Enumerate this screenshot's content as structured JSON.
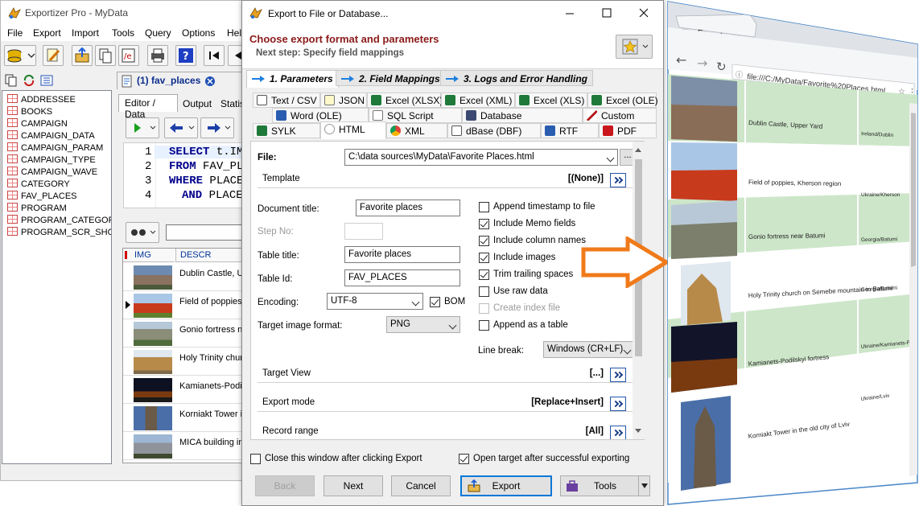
{
  "main": {
    "title": "Exportizer Pro - MyData",
    "menu": [
      "File",
      "Export",
      "Import",
      "Tools",
      "Query",
      "Options",
      "Help"
    ],
    "tables": [
      "ADDRESSEE",
      "BOOKS",
      "CAMPAIGN",
      "CAMPAIGN_DATA",
      "CAMPAIGN_PARAM",
      "CAMPAIGN_TYPE",
      "CAMPAIGN_WAVE",
      "CATEGORY",
      "FAV_PLACES",
      "PROGRAM",
      "PROGRAM_CATEGORY",
      "PROGRAM_SCR_SHOT"
    ],
    "doc_tab": "(1) fav_places",
    "inner_tabs": [
      "Editor / Data",
      "Output",
      "Statist"
    ],
    "sql": {
      "lines": [
        {
          "num": "1",
          "kw": "SELECT",
          "rest": " t.IMG"
        },
        {
          "num": "2",
          "kw": "FROM",
          "rest": " FAV_PLA"
        },
        {
          "num": "3",
          "kw": "WHERE",
          "rest": " PLACE"
        },
        {
          "num": "4",
          "kw": "AND",
          "rest": " PLACE"
        }
      ]
    },
    "grid": {
      "columns": [
        "IMG",
        "DESCR"
      ],
      "rows": [
        "Dublin Castle, Up",
        "Field of poppies,",
        "Gonio fortress ne",
        "Holy Trinity churc",
        "Kamianets-Podils",
        "Korniakt Tower ir",
        "MICA building in"
      ]
    }
  },
  "dialog": {
    "title": "Export to File or Database...",
    "heading": "Choose export format and parameters",
    "subheading": "Next step: Specify field mappings",
    "steps": [
      "1. Parameters",
      "2. Field Mappings",
      "3. Logs and Error Handling"
    ],
    "formats_row1": [
      "Text / CSV",
      "JSON",
      "Excel (XLSX)",
      "Excel (XML)",
      "Excel (XLS)",
      "Excel (OLE)"
    ],
    "formats_row2": [
      "Word (OLE)",
      "SQL Script",
      "Database",
      "Custom"
    ],
    "formats_row3": [
      "SYLK",
      "HTML",
      "XML",
      "dBase (DBF)",
      "RTF",
      "PDF"
    ],
    "file_label": "File:",
    "file_value": "C:\\data sources\\MyData\\Favorite Places.html",
    "browse": "...",
    "template_label": "Template",
    "template_value": "[(None)]",
    "doc_title_label": "Document title:",
    "doc_title_value": "Favorite places",
    "step_no_label": "Step No:",
    "table_title_label": "Table title:",
    "table_title_value": "Favorite places",
    "table_id_label": "Table Id:",
    "table_id_value": "FAV_PLACES",
    "encoding_label": "Encoding:",
    "encoding_value": "UTF-8",
    "bom_label": "BOM",
    "image_format_label": "Target image format:",
    "image_format_value": "PNG",
    "options": [
      {
        "label": "Append timestamp to file",
        "checked": false,
        "disabled": false
      },
      {
        "label": "Include Memo fields",
        "checked": true,
        "disabled": false
      },
      {
        "label": "Include column names",
        "checked": true,
        "disabled": false
      },
      {
        "label": "Include images",
        "checked": true,
        "disabled": false
      },
      {
        "label": "Trim trailing spaces",
        "checked": true,
        "disabled": false
      },
      {
        "label": "Use raw data",
        "checked": false,
        "disabled": false
      },
      {
        "label": "Create index file",
        "checked": false,
        "disabled": true
      },
      {
        "label": "Append as a table",
        "checked": false,
        "disabled": false
      }
    ],
    "line_break_label": "Line break:",
    "line_break_value": "Windows (CR+LF)",
    "target_view_label": "Target View",
    "target_view_value": "[...]",
    "export_mode_label": "Export mode",
    "export_mode_value": "[Replace+Insert]",
    "record_range_label": "Record range",
    "record_range_value": "[All]",
    "close_after_label": "Close this window after clicking Export",
    "open_target_label": "Open target after successful exporting",
    "buttons": {
      "back": "Back",
      "next": "Next",
      "cancel": "Cancel",
      "export": "Export",
      "tools": "Tools"
    }
  },
  "browser": {
    "tab_title": "Favorite Places",
    "url": "file:///C:/MyData/Favorite%20Places.html",
    "rows": [
      {
        "desc": "Dublin Castle, Upper Yard",
        "loc": "Ireland/Dublin"
      },
      {
        "desc": "Field of poppies, Kherson region",
        "loc": "Ukraine/Kherson"
      },
      {
        "desc": "Gonio fortress near Batumi",
        "loc": "Georgia/Batumi"
      },
      {
        "desc": "Holy Trinity church on Semebe mountain in Batumi",
        "loc": "Georgia/Batumi"
      },
      {
        "desc": "Kamianets-Podilskyi fortress",
        "loc": "Ukraine/Kamianets-Podilskyi"
      },
      {
        "desc": "Korniakt Tower in the old city of Lviv",
        "loc": "Ukraine/Lviv"
      }
    ]
  },
  "colors": {
    "accent": "#8b1a1a",
    "highlight_row": "#cde6c9",
    "arrow": "#f07a1a",
    "link_blue": "#1a3f8a"
  }
}
